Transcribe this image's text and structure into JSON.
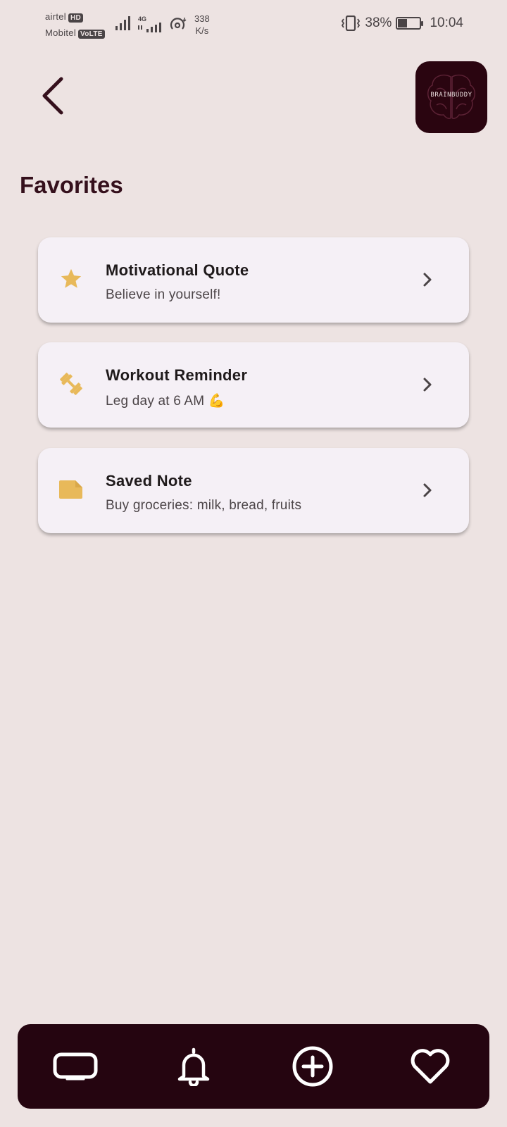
{
  "status_bar": {
    "carrier1": "airtel",
    "carrier1_tag": "HD",
    "carrier2": "Mobitel",
    "carrier2_tag": "VoLTE",
    "network": "4G",
    "speed_value": "338",
    "speed_unit": "K/s",
    "battery": "38%",
    "time": "10:04"
  },
  "header": {
    "back_icon": "chevron-left-icon",
    "logo_text": "BRAINBUDDY"
  },
  "page": {
    "title": "Favorites"
  },
  "favorites": [
    {
      "icon": "star-icon",
      "title": "Motivational Quote",
      "subtitle": "Believe in yourself!"
    },
    {
      "icon": "dumbbell-icon",
      "title": "Workout Reminder",
      "subtitle": "Leg day at 6 AM 💪"
    },
    {
      "icon": "note-icon",
      "title": "Saved Note",
      "subtitle": "Buy groceries: milk, bread, fruits"
    }
  ],
  "bottom_nav": [
    {
      "icon": "tv-icon"
    },
    {
      "icon": "bell-icon"
    },
    {
      "icon": "add-circle-icon"
    },
    {
      "icon": "heart-icon"
    }
  ],
  "colors": {
    "background": "#ede3e2",
    "card": "#f5f0f6",
    "accent_icon": "#e8b95a",
    "title": "#35101c",
    "nav_bar": "#250510"
  }
}
